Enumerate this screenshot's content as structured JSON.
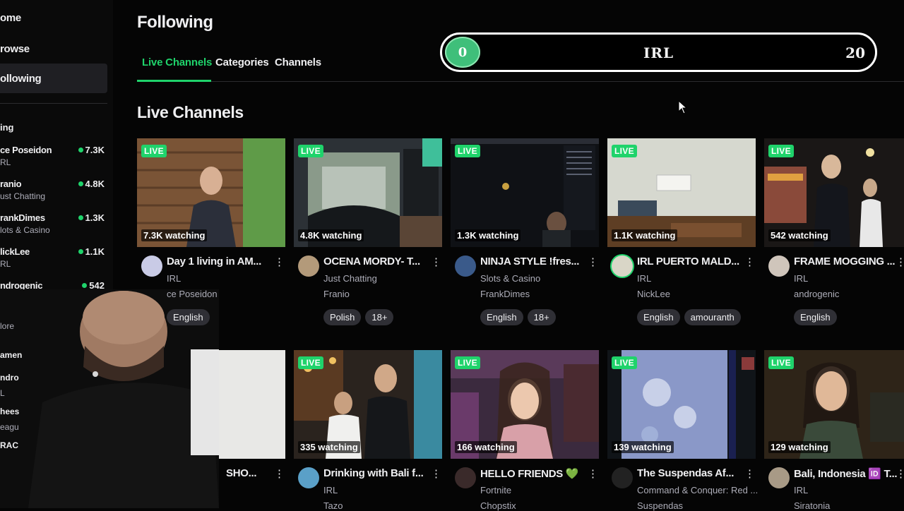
{
  "sidebar": {
    "nav": [
      {
        "label": "ome"
      },
      {
        "label": "rowse"
      },
      {
        "label": "ollowing"
      }
    ],
    "section_label": "ing",
    "channels": [
      {
        "name": "ce Poseidon",
        "category": "RL",
        "viewers": "7.3K"
      },
      {
        "name": "ranio",
        "category": "ust Chatting",
        "viewers": "4.8K"
      },
      {
        "name": "rankDimes",
        "category": "lots & Casino",
        "viewers": "1.3K"
      },
      {
        "name": "lickLee",
        "category": "RL",
        "viewers": "1.1K"
      },
      {
        "name": "ndrogenic",
        "category": "RL",
        "viewers": "542"
      }
    ],
    "more_label": "lore",
    "extra": [
      {
        "label": "amen"
      },
      {
        "label": "ndro"
      },
      {
        "label": "L"
      },
      {
        "label": "hees"
      },
      {
        "label": "eagu"
      },
      {
        "label": "RAC"
      }
    ]
  },
  "header": {
    "title": "Following"
  },
  "tabs": [
    {
      "label": "Live Channels"
    },
    {
      "label": "Categories"
    },
    {
      "label": "Channels"
    }
  ],
  "section_title": "Live Channels",
  "overlay": {
    "min": "0",
    "label": "IRL",
    "max": "20"
  },
  "live_label": "LIVE",
  "row1": [
    {
      "viewers": "7.3K watching",
      "title": "Day 1 living in AM...",
      "category": "IRL",
      "channel": "ce Poseidon",
      "tags": [
        "English"
      ],
      "avatar_color": "#c9cbe6"
    },
    {
      "viewers": "4.8K watching",
      "title": "OCENA MORDY- T...",
      "category": "Just Chatting",
      "channel": "Franio",
      "tags": [
        "Polish",
        "18+"
      ],
      "avatar_color": "#b39a7a"
    },
    {
      "viewers": "1.3K watching",
      "title": "NINJA STYLE !fres...",
      "category": "Slots & Casino",
      "channel": "FrankDimes",
      "tags": [
        "English",
        "18+"
      ],
      "avatar_color": "#3a5a8a"
    },
    {
      "viewers": "1.1K watching",
      "title": "IRL PUERTO MALD...",
      "category": "IRL",
      "channel": "NickLee",
      "tags": [
        "English",
        "amouranth"
      ],
      "avatar_color": "#d9d6c7"
    },
    {
      "viewers": "542 watching",
      "title": "FRAME MOGGING ...",
      "category": "IRL",
      "channel": "androgenic",
      "tags": [
        "English"
      ],
      "avatar_color": "#cfc5bb"
    }
  ],
  "row2": [
    {
      "viewers": "",
      "title": "SHO...",
      "category": "",
      "channel": ""
    },
    {
      "viewers": "335 watching",
      "title": "Drinking with Bali f...",
      "category": "IRL",
      "channel": "Tazo",
      "avatar_color": "#5aa0c8"
    },
    {
      "viewers": "166 watching",
      "title": "HELLO FRIENDS 💚",
      "category": "Fortnite",
      "channel": "Chopstix",
      "avatar_color": "#3a2a2a"
    },
    {
      "viewers": "139 watching",
      "title": "The Suspendas Af...",
      "category": "Command & Conquer: Red ...",
      "channel": "Suspendas",
      "avatar_color": "#222222"
    },
    {
      "viewers": "129 watching",
      "title": "Bali, Indonesia 🆔 T...",
      "category": "IRL",
      "channel": "Siratonia",
      "avatar_color": "#a89a86"
    }
  ],
  "colors": {
    "accent": "#1fd36b",
    "background": "#050505",
    "tag_bg": "#2f2f35"
  }
}
